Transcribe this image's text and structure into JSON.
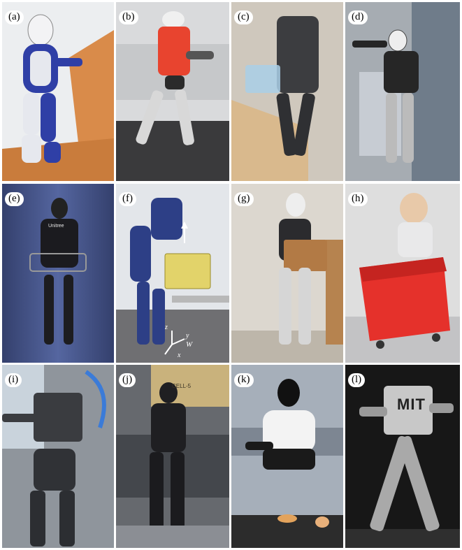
{
  "figure": {
    "panels": [
      {
        "id": "a",
        "label": "(a)"
      },
      {
        "id": "b",
        "label": "(b)"
      },
      {
        "id": "c",
        "label": "(c)"
      },
      {
        "id": "d",
        "label": "(d)"
      },
      {
        "id": "e",
        "label": "(e)",
        "shirt_text": "Unitree"
      },
      {
        "id": "f",
        "label": "(f)",
        "axis_z": "z",
        "axis_y": "y",
        "axis_x": "x",
        "frame_symbol": "W"
      },
      {
        "id": "g",
        "label": "(g)"
      },
      {
        "id": "h",
        "label": "(h)"
      },
      {
        "id": "i",
        "label": "(i)"
      },
      {
        "id": "j",
        "label": "(j)",
        "sign_text": "CELL-5"
      },
      {
        "id": "k",
        "label": "(k)"
      },
      {
        "id": "l",
        "label": "(l)",
        "logo_text": "MIT"
      }
    ]
  }
}
